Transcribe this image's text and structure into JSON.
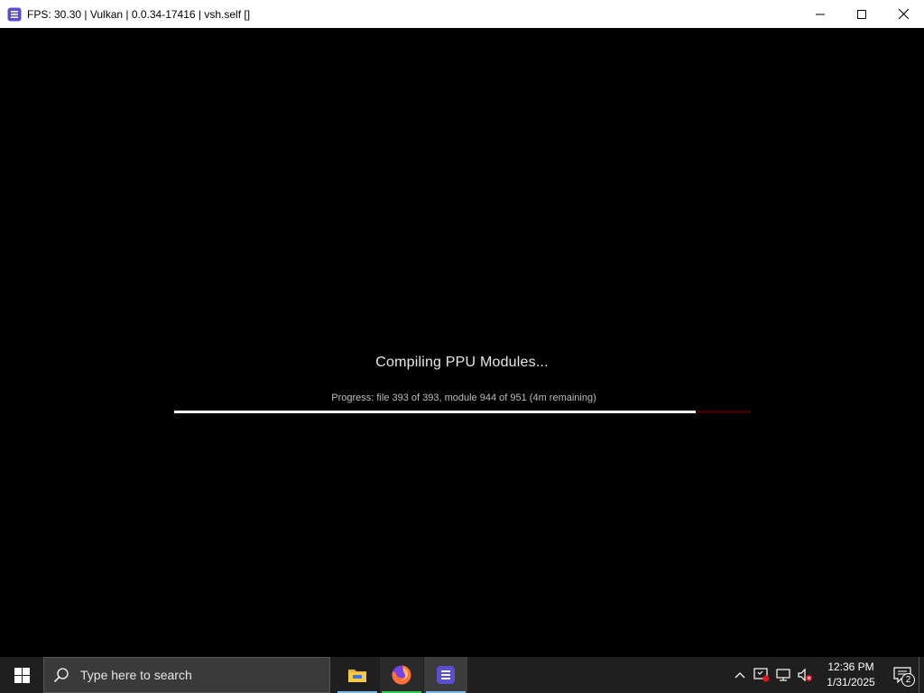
{
  "window": {
    "title": "FPS: 30.30 | Vulkan | 0.0.34-17416 | vsh.self []",
    "icon": "rpcs3-app-icon",
    "controls": [
      "minimize-icon",
      "maximize-icon",
      "close-icon"
    ]
  },
  "compile": {
    "title": "Compiling PPU Modules...",
    "progress_text": "Progress: file 393 of 393, module 944 of 951 (4m remaining)",
    "progress_fraction": 0.905,
    "fill_color": "#ffffff",
    "track_color": "#3a0000"
  },
  "taskbar": {
    "start_icon": "windows-logo-icon",
    "search_placeholder": "Type here to search",
    "apps": [
      {
        "name": "file-explorer-icon",
        "underline_color": "#76b9ed"
      },
      {
        "name": "firefox-icon",
        "underline_color": "#2fd04f"
      },
      {
        "name": "rpcs3-icon",
        "underline_color": "#76b9ed"
      }
    ],
    "tray": {
      "icons": [
        "chevron-up-icon",
        "security-center-icon",
        "network-icon",
        "volume-muted-icon"
      ],
      "time": "12:36 PM",
      "date": "1/31/2025",
      "notification_count": "2"
    }
  }
}
